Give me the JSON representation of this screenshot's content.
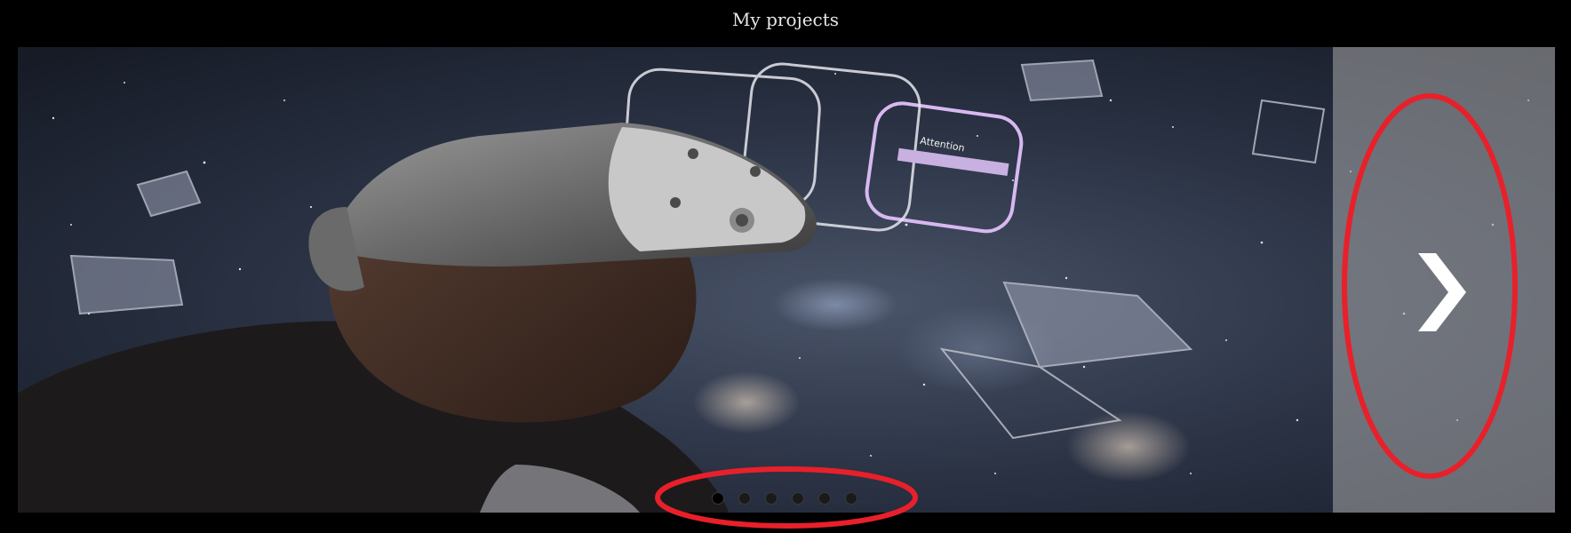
{
  "page": {
    "title": "My projects"
  },
  "carousel": {
    "slide": {
      "image_label": "Attention"
    },
    "dots_count": 6,
    "active_dot": 0,
    "next_icon": "chevron-right-icon"
  },
  "colors": {
    "background": "#000000",
    "title_text": "#e6e6e6",
    "annotation": "#e8202a",
    "next_panel": "#aaaaaa"
  }
}
